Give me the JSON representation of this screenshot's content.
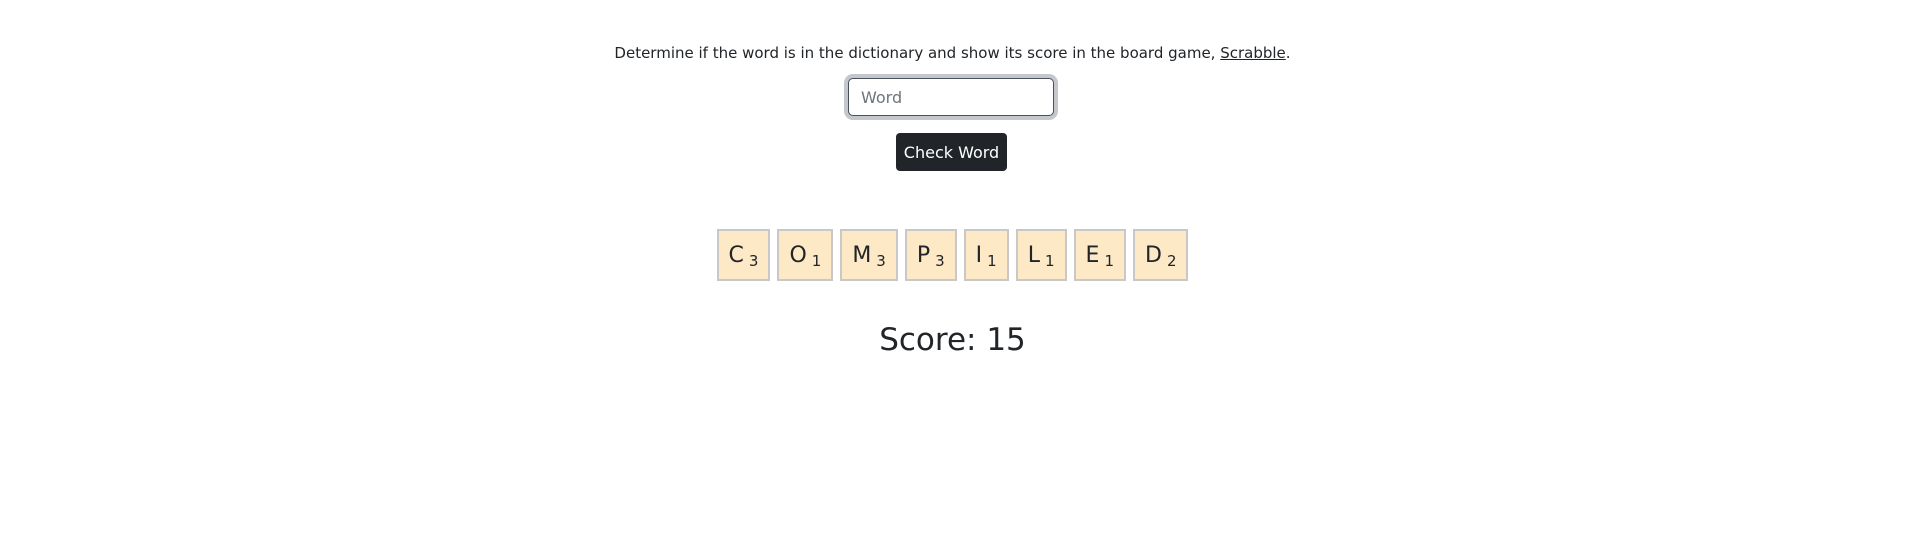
{
  "intro": {
    "text": "Determine if the word is in the dictionary and show its score in the board game, ",
    "link_label": "Scrabble",
    "trailing": "."
  },
  "word_input": {
    "value": "",
    "placeholder": "Word"
  },
  "check_button": {
    "label": "Check Word"
  },
  "tiles": [
    {
      "letter": "C",
      "points": "3"
    },
    {
      "letter": "O",
      "points": "1"
    },
    {
      "letter": "M",
      "points": "3"
    },
    {
      "letter": "P",
      "points": "3"
    },
    {
      "letter": "I",
      "points": "1"
    },
    {
      "letter": "L",
      "points": "1"
    },
    {
      "letter": "E",
      "points": "1"
    },
    {
      "letter": "D",
      "points": "2"
    }
  ],
  "score": {
    "label": "Score: 15"
  },
  "colors": {
    "tile_background": "#fde9c5",
    "tile_border": "#c8c8c8",
    "button_background": "#212529",
    "text": "#212529"
  }
}
